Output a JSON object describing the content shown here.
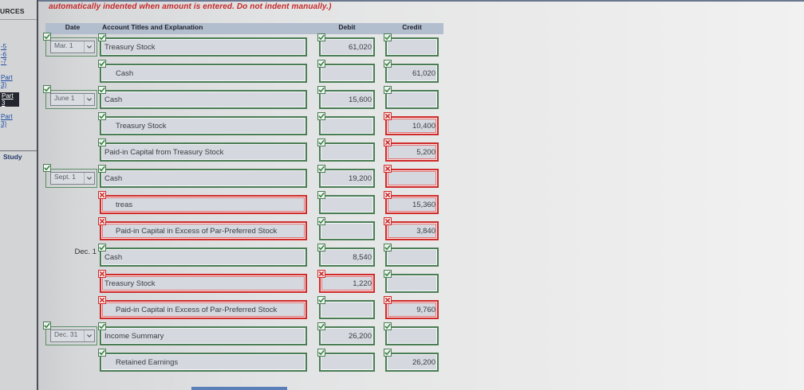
{
  "sidebar": {
    "header": "URCES",
    "links": [
      {
        "lines": [
          "-5"
        ]
      },
      {
        "lines": [
          "-6"
        ]
      },
      {
        "lines": [
          "-7"
        ]
      },
      {
        "lines": [
          "Part",
          "3)"
        ]
      },
      {
        "lines": [
          "Part",
          "3"
        ],
        "active": true
      },
      {
        "lines": [
          "Part",
          "3)"
        ]
      }
    ],
    "study": "Study"
  },
  "instruction": "automatically indented when amount is entered. Do not indent manually.)",
  "table": {
    "headers": {
      "date": "Date",
      "account": "Account Titles and Explanation",
      "debit": "Debit",
      "credit": "Credit"
    },
    "rows": [
      {
        "date": {
          "text": "Mar. 1",
          "select": true,
          "icon": "check-icon"
        },
        "account": {
          "text": "Treasury Stock",
          "indented": false,
          "icon": "check-icon"
        },
        "debit": {
          "text": "61,020",
          "icon": "check-icon"
        },
        "credit": {
          "text": "",
          "icon": "check-icon"
        }
      },
      {
        "account": {
          "text": "Cash",
          "indented": true,
          "icon": "check-icon"
        },
        "debit": {
          "text": "",
          "icon": "check-icon"
        },
        "credit": {
          "text": "61,020",
          "icon": "check-icon"
        }
      },
      {
        "date": {
          "text": "June 1",
          "select": true,
          "icon": "check-icon"
        },
        "account": {
          "text": "Cash",
          "indented": false,
          "icon": "check-icon"
        },
        "debit": {
          "text": "15,600",
          "icon": "check-icon"
        },
        "credit": {
          "text": "",
          "icon": "check-icon"
        }
      },
      {
        "account": {
          "text": "Treasury Stock",
          "indented": true,
          "icon": "check-icon"
        },
        "debit": {
          "text": "",
          "icon": "check-icon"
        },
        "credit": {
          "text": "10,400",
          "icon": "x-icon"
        }
      },
      {
        "account": {
          "text": "Paid-in Capital from Treasury Stock",
          "indented": false,
          "icon": "check-icon"
        },
        "debit": {
          "text": "",
          "icon": "check-icon"
        },
        "credit": {
          "text": "5,200",
          "icon": "x-icon"
        }
      },
      {
        "date": {
          "text": "Sept. 1",
          "select": true,
          "icon": "check-icon"
        },
        "account": {
          "text": "Cash",
          "indented": false,
          "icon": "check-icon"
        },
        "debit": {
          "text": "19,200",
          "icon": "check-icon"
        },
        "credit": {
          "text": "",
          "icon": "x-icon"
        }
      },
      {
        "account": {
          "text": "treas",
          "indented": true,
          "icon": "x-icon"
        },
        "debit": {
          "text": "",
          "icon": "check-icon"
        },
        "credit": {
          "text": "15,360",
          "icon": "x-icon"
        }
      },
      {
        "account": {
          "text": "Paid-in Capital in Excess of Par-Preferred Stock",
          "indented": true,
          "icon": "x-icon"
        },
        "debit": {
          "text": "",
          "icon": "check-icon"
        },
        "credit": {
          "text": "3,840",
          "icon": "x-icon"
        }
      },
      {
        "date": {
          "text": "Dec. 1",
          "select": false
        },
        "account": {
          "text": "Cash",
          "indented": false,
          "icon": "check-icon"
        },
        "debit": {
          "text": "8,540",
          "icon": "check-icon"
        },
        "credit": {
          "text": "",
          "icon": "check-icon"
        }
      },
      {
        "account": {
          "text": "Treasury Stock",
          "indented": false,
          "icon": "x-icon"
        },
        "debit": {
          "text": "1,220",
          "icon": "x-icon"
        },
        "credit": {
          "text": "",
          "icon": "check-icon"
        }
      },
      {
        "account": {
          "text": "Paid-in Capital in Excess of Par-Preferred Stock",
          "indented": true,
          "icon": "x-icon"
        },
        "debit": {
          "text": "",
          "icon": "check-icon"
        },
        "credit": {
          "text": "9,760",
          "icon": "x-icon"
        }
      },
      {
        "date": {
          "text": "Dec. 31",
          "select": true,
          "icon": "check-icon"
        },
        "account": {
          "text": "Income Summary",
          "indented": false,
          "icon": "check-icon"
        },
        "debit": {
          "text": "26,200",
          "icon": "check-icon"
        },
        "credit": {
          "text": "",
          "icon": "check-icon"
        }
      },
      {
        "account": {
          "text": "Retained Earnings",
          "indented": true,
          "icon": "check-icon"
        },
        "debit": {
          "text": "",
          "icon": "check-icon"
        },
        "credit": {
          "text": "26,200",
          "icon": "check-icon"
        }
      }
    ]
  },
  "colors": {
    "correct": "#4b7d55",
    "incorrect": "#cf2b2b",
    "header_bg": "#b2bdcd",
    "instruction": "#c62828",
    "link": "#1d4ea3"
  }
}
